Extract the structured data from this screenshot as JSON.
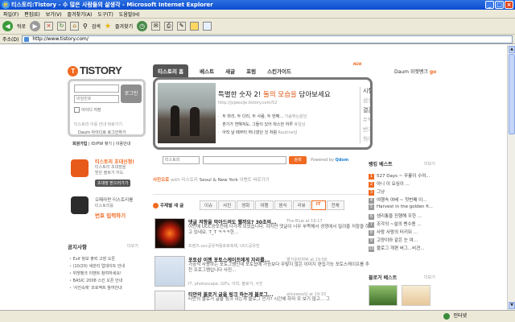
{
  "window": {
    "title": "티스토리:Tistory - 수 많은 사람들의 삶생각 - Microsoft Internet Explorer",
    "buttons": [
      "_",
      "□",
      "×"
    ]
  },
  "menubar": [
    "파일(F)",
    "편집(E)",
    "보기(V)",
    "즐겨찾기(A)",
    "도구(T)",
    "도움말(H)"
  ],
  "toolbar": {
    "back_label": "뒤로",
    "search_label": "검색",
    "favorites_label": "즐겨찾기"
  },
  "address": {
    "label": "주소(D)",
    "url": "http://www.tistory.com/"
  },
  "status": {
    "zone": "인터넷"
  },
  "site": {
    "logo": "TISTORY",
    "logo_badge": "T",
    "nav": [
      "티스토리 홈",
      "베스트",
      "새글",
      "포럼",
      "스킨가이드"
    ],
    "nav_new": "NEW",
    "daum_label": "Daum 위젯뱅크",
    "daum_go": "go"
  },
  "login": {
    "id_placeholder": "",
    "pw_placeholder": "비밀번호",
    "button": "로그인",
    "remember": "아이디 저장",
    "line1": "티스토리 이용 안내 바로가기",
    "line2": "Daum 아이디로 로그인하기",
    "join_prefix": "회원가입",
    "join_rest": " | ID/PW 찾기 | 이용안내"
  },
  "feature": {
    "headline_a": "특별한 숫자 2! ",
    "headline_hl": "둘의 모습을",
    "headline_b": " 담아보세요",
    "url": "http://jvjaeulje.tistory.com/52",
    "bullets": [
      {
        "text": "두 마리, 두 다리, 두 사람, 두 번째...",
        "src": "가슴뛰는삶넘"
      },
      {
        "text": "혼기가 연해져도, 그들이 있어 따스한 하루",
        "src": "휴일님"
      },
      {
        "text": "아직 날 떼부터 하나였던 것 처럼",
        "src": "Rautine님"
      }
    ],
    "keywords": [
      "시험",
      "삼성",
      "결혼",
      "뮤직비디오",
      "반크",
      "하이뜨"
    ]
  },
  "search": {
    "select": "티스토리",
    "button": "검색",
    "powered": "Powered by",
    "powered_brand": "Qdom"
  },
  "promos": [
    {
      "title": "티스토리 초대신청!",
      "text1": "티스토리 초대장을",
      "text2": "받은 블로거 지도",
      "pill": "초대장 받으러가기"
    },
    {
      "title": "오페라펀 티스토리를",
      "text1": "",
      "text2": "티스토리를",
      "pill": "번호 입력하기"
    }
  ],
  "tokyo": {
    "a": "사진으로 ",
    "b": "with 티스토리",
    "c": "  Seoul & New York  ",
    "d": "이벤트 바로가기"
  },
  "category": {
    "label": "주제별 새 글",
    "tabs": [
      "이슈",
      "사진",
      "영화",
      "여행",
      "음식",
      "리뷰",
      "IT",
      "전체"
    ],
    "active": "IT"
  },
  "posts": [
    {
      "title": "댓글 저항을 막아드려도 웰까요? 30초의...",
      "meta": "The Blue   at 19:17",
      "body": "이번에 UCC공모전에 나가게 되었습니다. 하지만 댓글이 너무 부족해서 경쟁에서 밀려줄 저항을 하고 있네요. T_T ㅋㅋㅋ한...",
      "tags": "프렌즈:ucc공유적용포로축제, UCC공유전"
    },
    {
      "title": "포토샵 이젠 포토스케이프에게 자리를...",
      "meta": "열거운판위탁 at 19:58",
      "body": "가끔식 사용하는 포토그램인데 포토샵에 가능보다 무렇지 않은 이미지 편집기능 포토스케이프를 추천 프로그램입니다 사진...",
      "tags": "IT, photoscape, GIFs, 이미, 블로거, 사진"
    },
    {
      "title": "티안의 블로거 글을 링크 하는게 블로그...",
      "meta": "alicewoo님 at 19:33",
      "body": "티안의 블로거 글을 링크 하는게 블로그 인가? 시간에 하자 모 보기 않고... 그",
      "tags": ""
    }
  ],
  "notice": {
    "title": "공지사항",
    "more": "더보기",
    "items": [
      "Exif 정보 출력 고장 오픈",
      "(10/20) 새관리 업데이트 안내",
      "위젯뱅크 이벤트 참여하세요!",
      "BASIC 2008 스킨 오픈 안내",
      "'사진속에' 프로젝트 참여안내"
    ]
  },
  "right": {
    "ranking_title": "랭킹 베스트",
    "more": "더보기",
    "items": [
      "527 Days ~ 무릎이 수여...",
      "아니 이 요심이 ...",
      "그냥",
      "여행속 여배 ~ 첫번째 이...",
      "Harvest in the golden fi...",
      "생리통을 진행해 우한 ...",
      "조각의 ~설의 벤수용 ...",
      "사람 사람의 터키뒤 ...",
      "고양이와 같은 눈 여...",
      "블로그 개편 버그...비견..."
    ],
    "best_title": "블로거 베스트"
  }
}
